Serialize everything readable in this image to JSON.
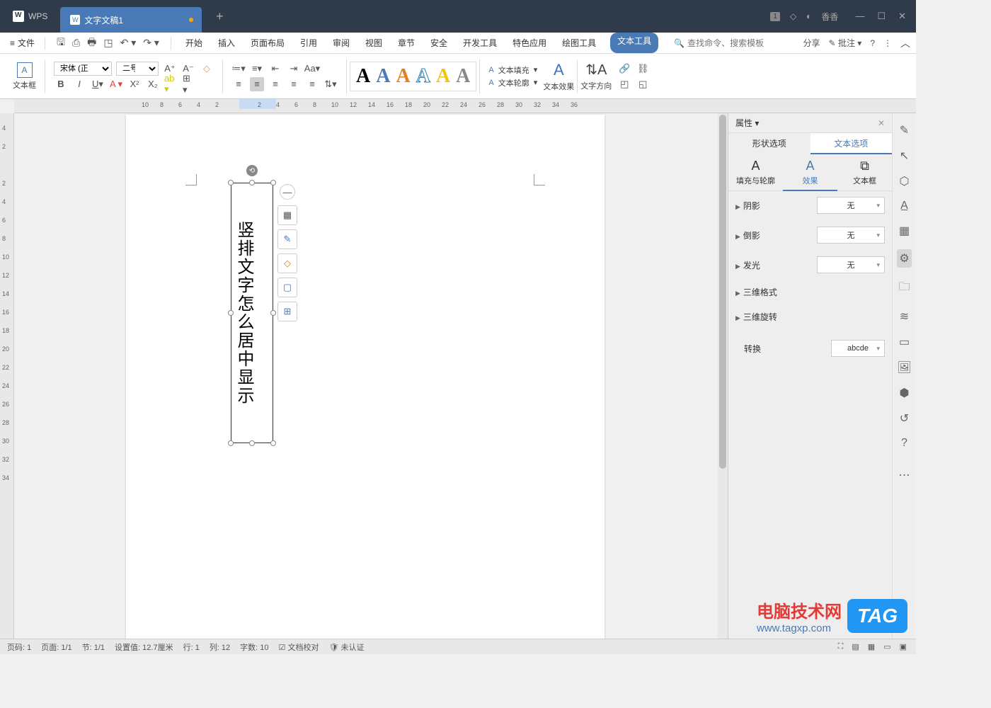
{
  "titlebar": {
    "app_name": "WPS",
    "doc_name": "文字文稿1",
    "badge": "1",
    "user": "香香"
  },
  "menu": {
    "file": "文件",
    "tabs": [
      "开始",
      "插入",
      "页面布局",
      "引用",
      "审阅",
      "视图",
      "章节",
      "安全",
      "开发工具",
      "特色应用",
      "绘图工具",
      "文本工具"
    ],
    "active_tab": "文本工具",
    "search_placeholder": "查找命令、搜索模板",
    "share": "分享",
    "comment": "批注"
  },
  "ribbon": {
    "textbox_label": "文本框",
    "font_name": "宋体 (正文)",
    "font_size": "二号",
    "text_fill": "文本填充",
    "text_outline": "文本轮廓",
    "text_effects": "文本效果",
    "text_direction": "文字方向"
  },
  "ruler_h": [
    "10",
    "8",
    "6",
    "4",
    "2",
    "2",
    "4",
    "6",
    "8",
    "10",
    "12",
    "14",
    "16",
    "18",
    "20",
    "22",
    "24",
    "26",
    "28",
    "30",
    "32",
    "34",
    "36"
  ],
  "ruler_v": [
    "4",
    "2",
    "2",
    "4",
    "6",
    "8",
    "10",
    "12",
    "14",
    "16",
    "18",
    "20",
    "22",
    "24",
    "26",
    "28",
    "30",
    "32",
    "34"
  ],
  "textbox_content": "竖排文字怎么居中显示",
  "props": {
    "title": "属性",
    "tab_shape": "形状选项",
    "tab_text": "文本选项",
    "sub_fill": "填充与轮廓",
    "sub_effect": "效果",
    "sub_textbox": "文本框",
    "shadow": "阴影",
    "reflection": "倒影",
    "glow": "发光",
    "format3d": "三维格式",
    "rotate3d": "三维旋转",
    "transform": "转换",
    "none": "无",
    "abcde": "abcde"
  },
  "status": {
    "page_no": "页码: 1",
    "page": "页面: 1/1",
    "section": "节: 1/1",
    "setvalue": "设置值: 12.7厘米",
    "row": "行: 1",
    "col": "列: 12",
    "words": "字数: 10",
    "proof": "文档校对",
    "auth": "未认证"
  },
  "watermark": {
    "site_name": "电脑技术网",
    "url": "www.tagxp.com",
    "tag": "TAG"
  }
}
